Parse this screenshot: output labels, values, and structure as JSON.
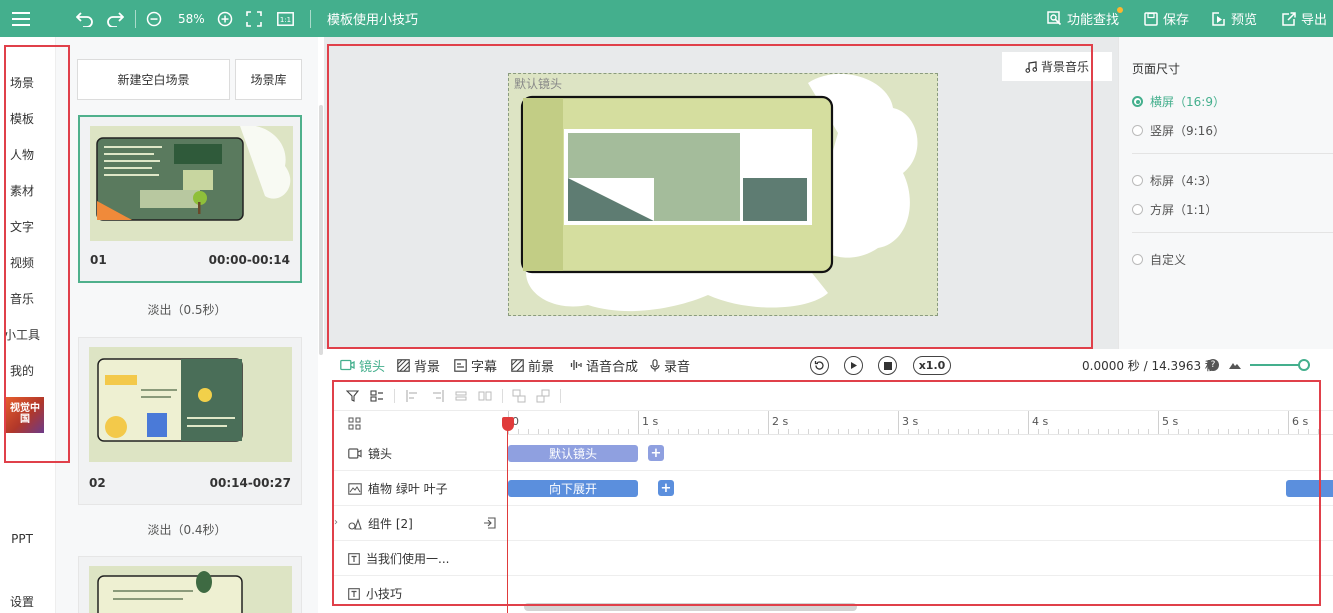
{
  "topbar": {
    "zoom": "58%",
    "project_title": "模板使用小技巧",
    "actions": {
      "feature_search": "功能查找",
      "save": "保存",
      "preview": "预览",
      "export": "导出"
    }
  },
  "rail": {
    "items": [
      "场景",
      "模板",
      "人物",
      "素材",
      "文字",
      "视频",
      "音乐",
      "小工具",
      "我的"
    ],
    "logo_text": "视觉中国",
    "bottom": [
      "PPT",
      "设置"
    ]
  },
  "scenes": {
    "new_blank": "新建空白场景",
    "library": "场景库",
    "cards": [
      {
        "num": "01",
        "time": "00:00-00:14",
        "transition": "淡出（0.5秒）"
      },
      {
        "num": "02",
        "time": "00:14-00:27",
        "transition": "淡出（0.4秒）"
      }
    ]
  },
  "canvas": {
    "bgm_label": "背景音乐",
    "stage_label": "默认镜头"
  },
  "page_size": {
    "title": "页面尺寸",
    "options": [
      "横屏（16:9）",
      "竖屏（9:16）",
      "标屏（4:3）",
      "方屏（1:1）",
      "自定义"
    ],
    "selected": 0
  },
  "toolbar_tabs": [
    "镜头",
    "背景",
    "字幕",
    "前景",
    "语音合成",
    "录音"
  ],
  "playback": {
    "speed": "x1.0",
    "time_readout": "0.0000 秒 / 14.3963 秒"
  },
  "timeline": {
    "ruler": [
      "0",
      "1 s",
      "2 s",
      "3 s",
      "4 s",
      "5 s",
      "6 s"
    ],
    "rows": [
      {
        "label": "镜头",
        "clip": "默认镜头"
      },
      {
        "label": "植物 绿叶 叶子",
        "clip": "向下展开"
      },
      {
        "label": "组件 [2]"
      },
      {
        "label": "当我们使用一..."
      },
      {
        "label": "小技巧"
      }
    ]
  },
  "colors": {
    "brand": "#44af8d",
    "clip_camera": "#8fa0e0",
    "clip_anim": "#5b8fdd",
    "playhead": "#e03b3b",
    "highlight": "#e0404a"
  }
}
